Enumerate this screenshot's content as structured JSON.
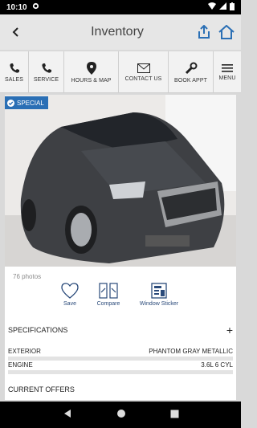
{
  "status": {
    "time": "10:10"
  },
  "header": {
    "title": "Inventory"
  },
  "shortcuts": [
    {
      "label": "SALES",
      "icon": "phone-icon"
    },
    {
      "label": "SERVICE",
      "icon": "phone-icon"
    },
    {
      "label": "HOURS & MAP",
      "icon": "map-pin-icon"
    },
    {
      "label": "CONTACT US",
      "icon": "mail-icon"
    },
    {
      "label": "BOOK APPT",
      "icon": "wrench-icon"
    },
    {
      "label": "MENU",
      "icon": "hamburger-icon"
    }
  ],
  "vehicle": {
    "badge": "SPECIAL",
    "photo_count": "76 photos"
  },
  "tools": {
    "save": "Save",
    "compare": "Compare",
    "sticker": "Window Sticker"
  },
  "specs": {
    "heading": "SPECIFICATIONS",
    "expand": "+",
    "rows": [
      {
        "label": "EXTERIOR",
        "value": "PHANTOM GRAY METALLIC"
      },
      {
        "label": "ENGINE",
        "value": "3.6L 6 CYL"
      }
    ]
  },
  "offers": {
    "heading": "CURRENT OFFERS"
  },
  "colors": {
    "accent": "#2a6fb5",
    "badge": "#2a6fb5",
    "status_bar": "#000000"
  }
}
